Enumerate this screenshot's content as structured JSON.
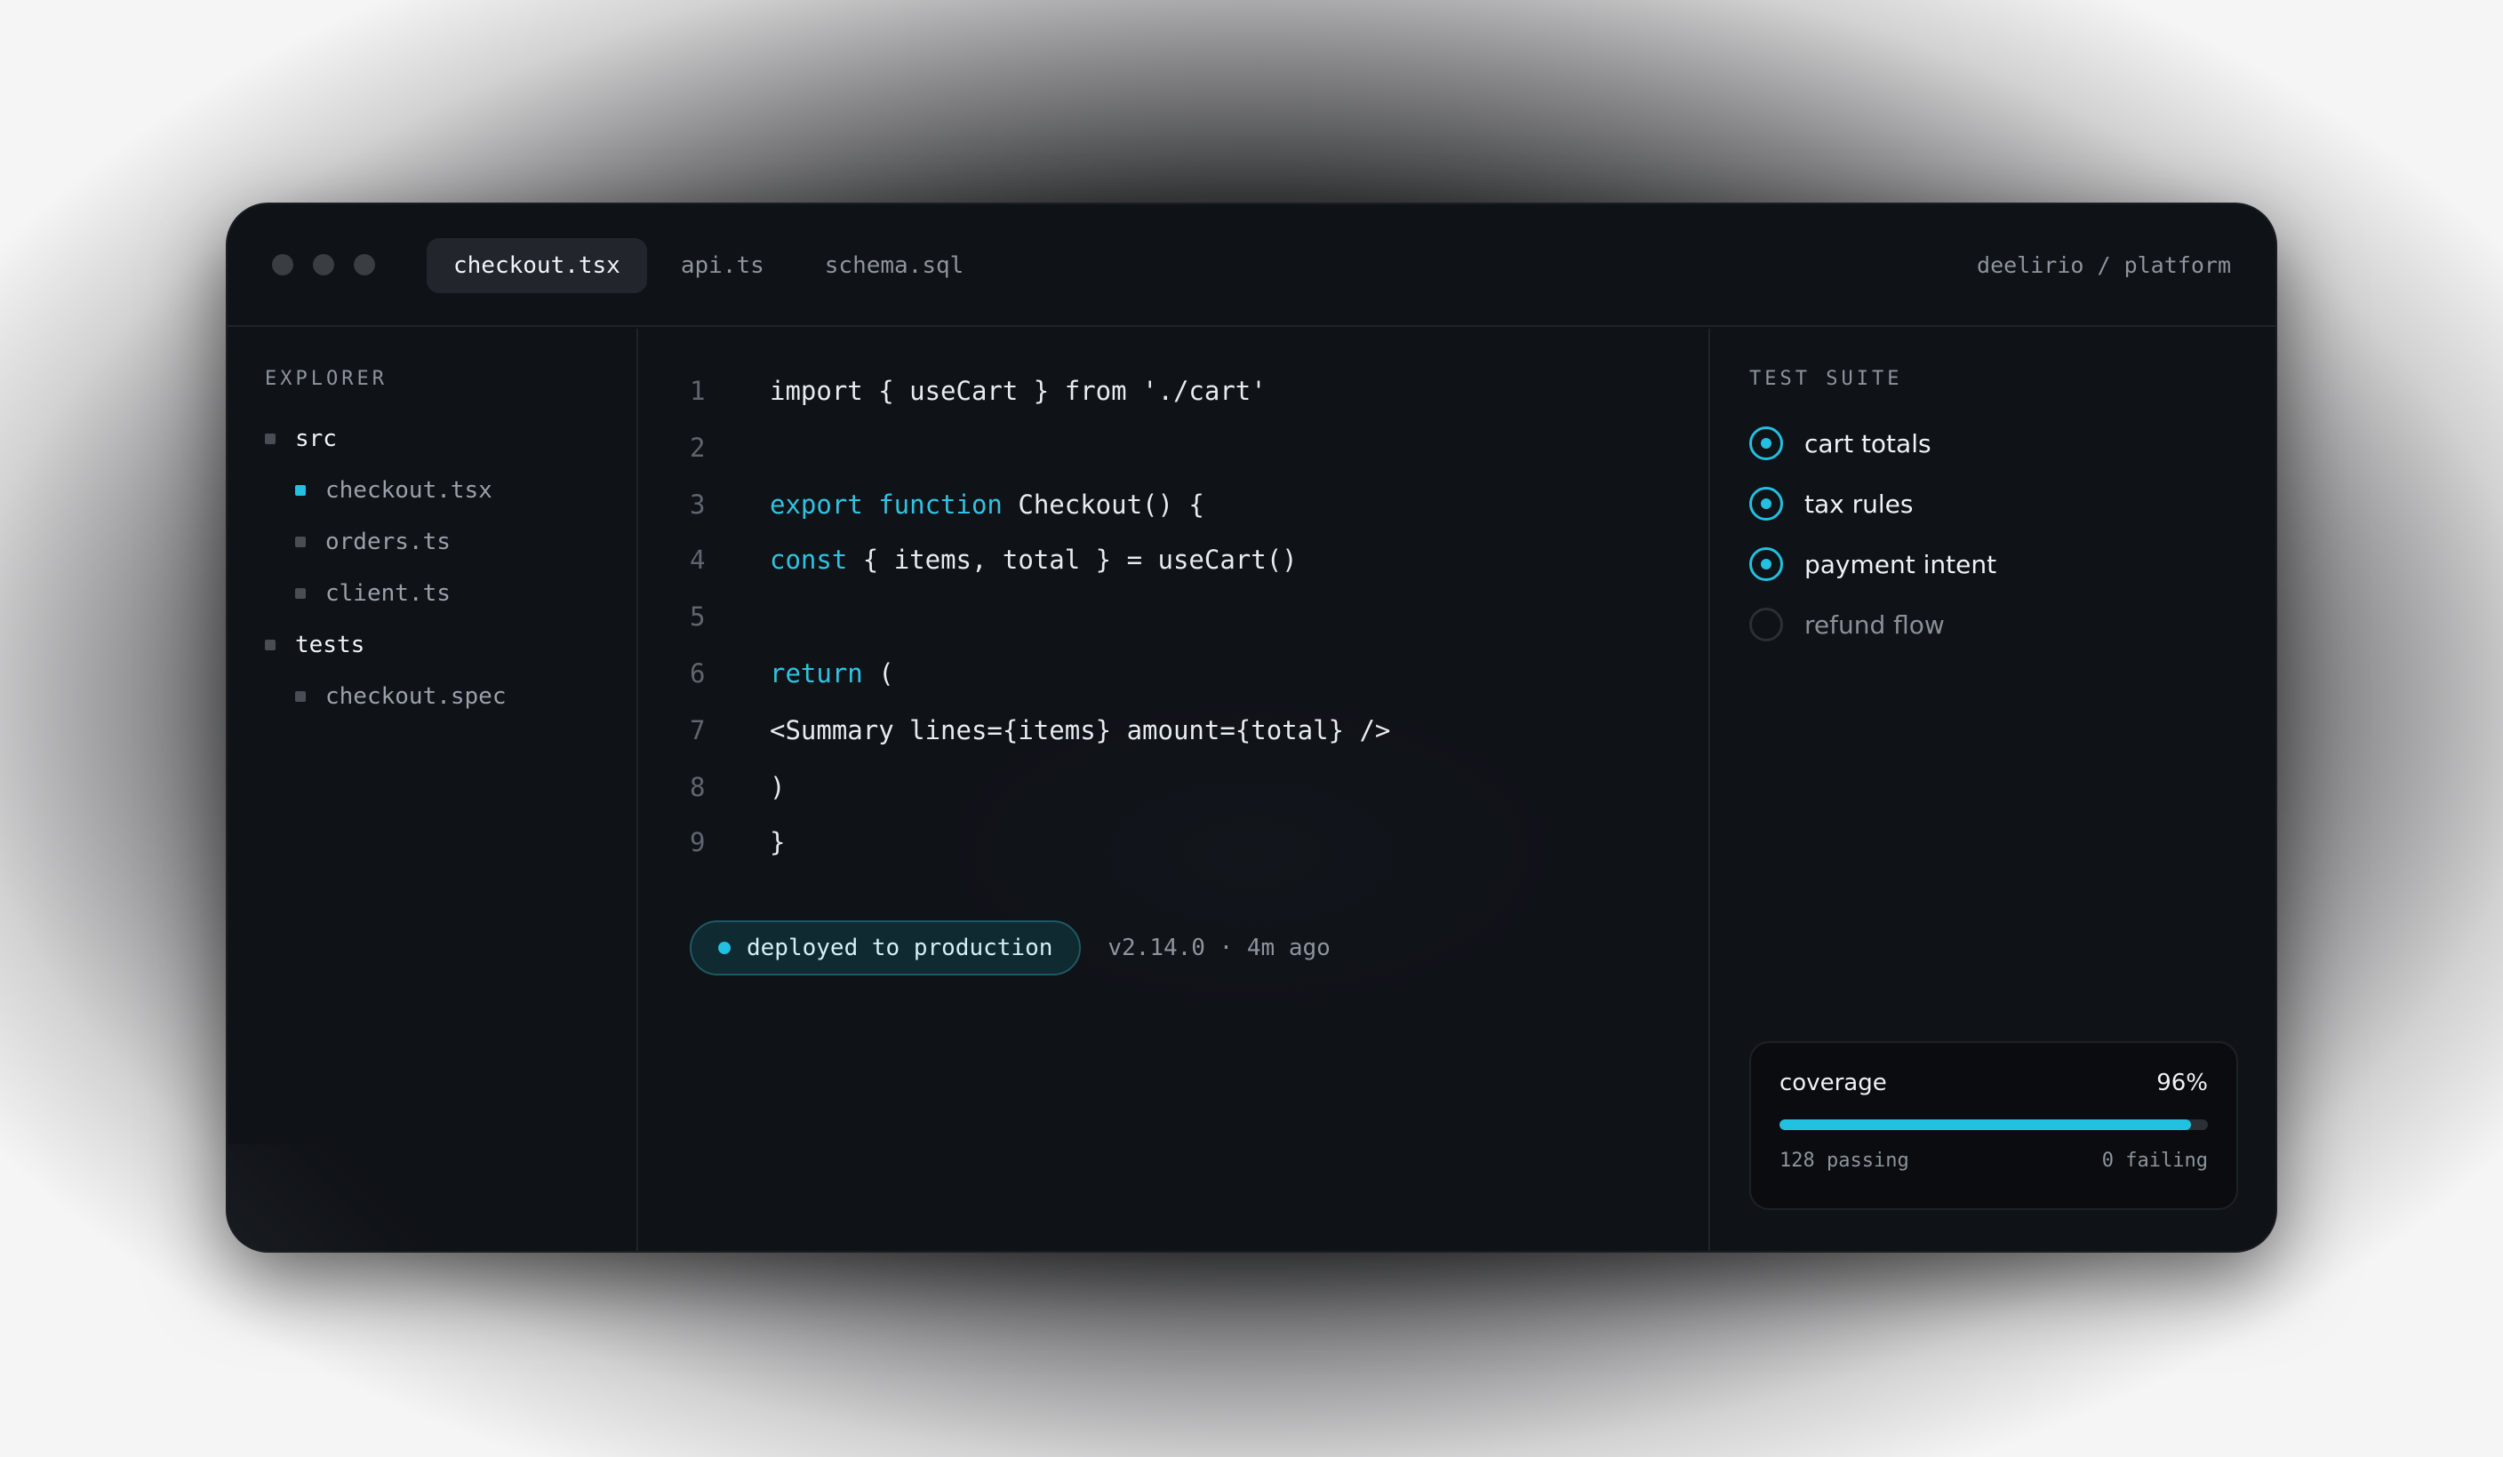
{
  "titlebar": {
    "tabs": [
      {
        "label": "checkout.tsx",
        "active": true
      },
      {
        "label": "api.ts",
        "active": false
      },
      {
        "label": "schema.sql",
        "active": false
      }
    ],
    "repo": "deelirio / platform"
  },
  "explorer": {
    "title": "EXPLORER",
    "items": [
      {
        "label": "src",
        "kind": "folder"
      },
      {
        "label": "checkout.tsx",
        "kind": "file",
        "active": true
      },
      {
        "label": "orders.ts",
        "kind": "file"
      },
      {
        "label": "client.ts",
        "kind": "file"
      },
      {
        "label": "tests",
        "kind": "folder"
      },
      {
        "label": "checkout.spec",
        "kind": "file"
      }
    ]
  },
  "editor": {
    "lines": [
      {
        "n": "1",
        "kw": "",
        "text": "import { useCart } from './cart'"
      },
      {
        "n": "2",
        "kw": "",
        "text": ""
      },
      {
        "n": "3",
        "kw": "export function",
        "text": " Checkout() {"
      },
      {
        "n": "4",
        "kw": "const",
        "text": " { items, total } = useCart()"
      },
      {
        "n": "5",
        "kw": "",
        "text": ""
      },
      {
        "n": "6",
        "kw": "return",
        "text": " ("
      },
      {
        "n": "7",
        "kw": "",
        "text": "<Summary lines={items} amount={total} />"
      },
      {
        "n": "8",
        "kw": "",
        "text": ")"
      },
      {
        "n": "9",
        "kw": "",
        "text": "}"
      }
    ],
    "deploy_status": "deployed to production",
    "version": "v2.14.0 · 4m ago"
  },
  "tests": {
    "title": "TEST SUITE",
    "items": [
      {
        "label": "cart totals",
        "passed": true
      },
      {
        "label": "tax rules",
        "passed": true
      },
      {
        "label": "payment intent",
        "passed": true
      },
      {
        "label": "refund flow",
        "passed": false
      }
    ],
    "coverage": {
      "label": "coverage",
      "value_text": "96%",
      "fraction": 0.96,
      "passing": "128 passing",
      "failing": "0 failing"
    }
  },
  "colors": {
    "accent": "#22c1e1",
    "background": "#0f1217"
  }
}
